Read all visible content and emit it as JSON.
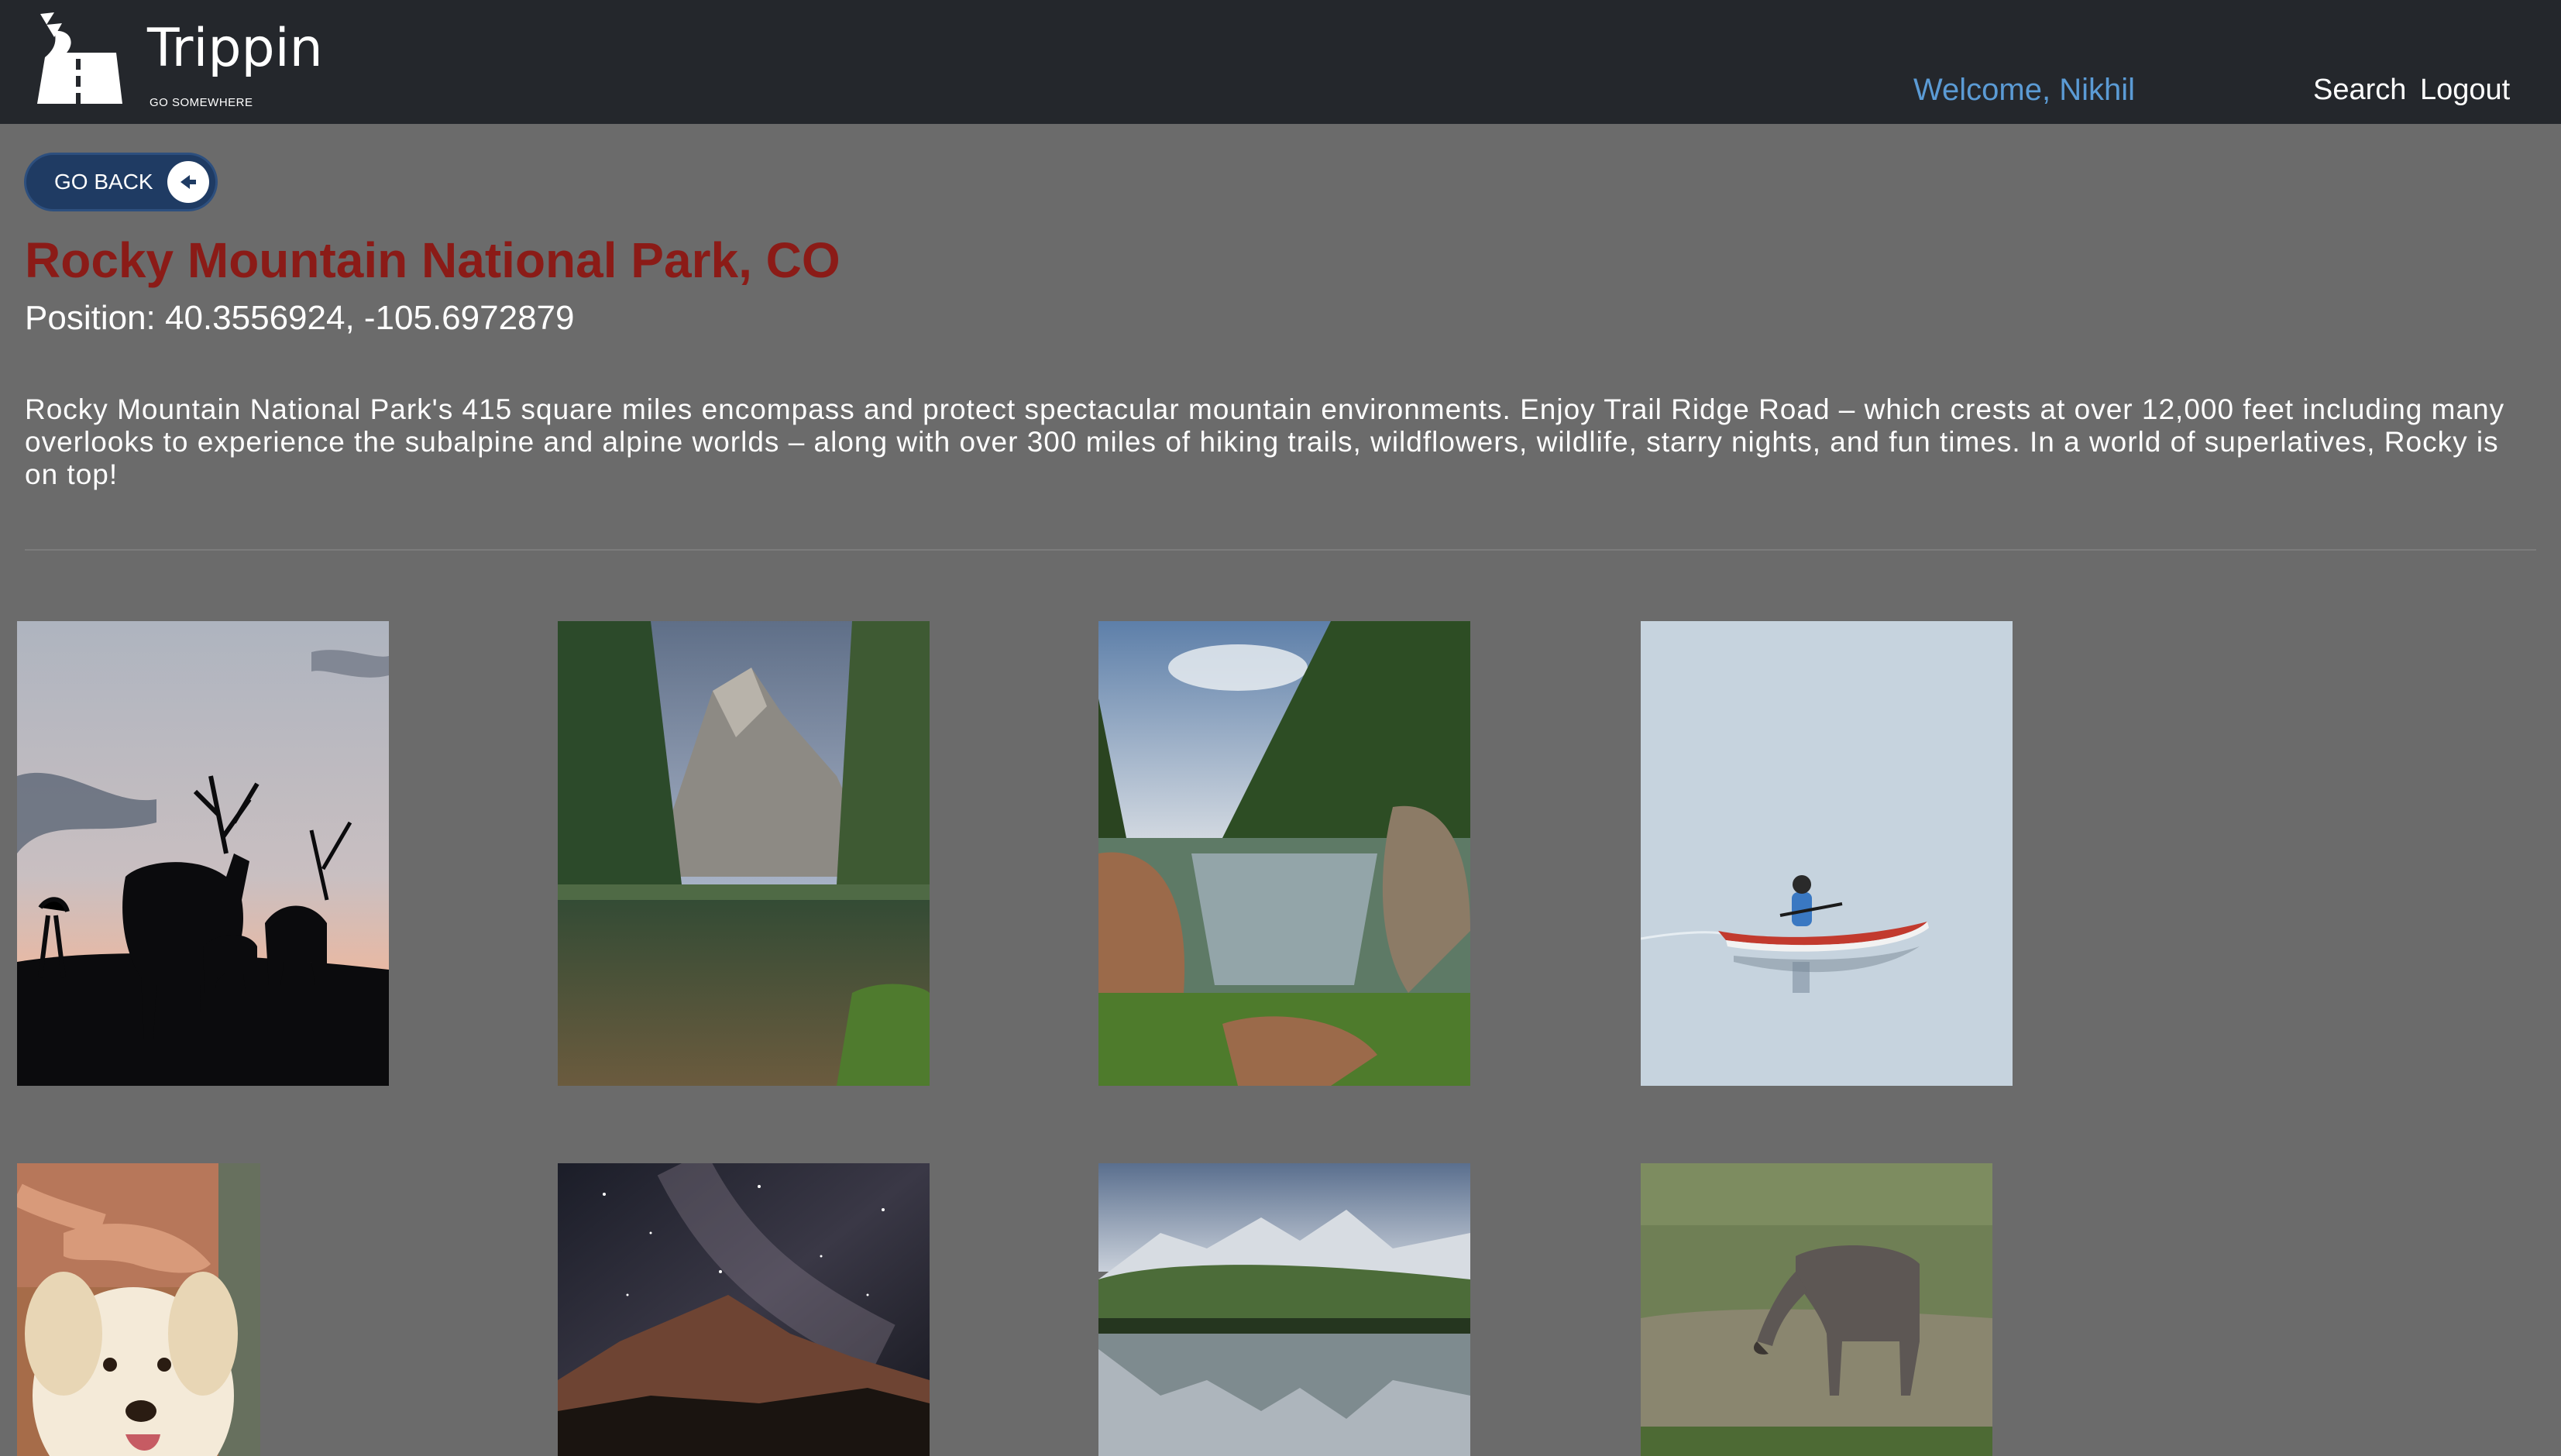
{
  "header": {
    "brand": "Trippin",
    "tagline": "GO SOMEWHERE",
    "welcome": "Welcome, Nikhil",
    "search_label": "Search",
    "logout_label": "Logout"
  },
  "go_back_label": "GO BACK",
  "park": {
    "title": "Rocky Mountain National Park, CO",
    "position": "Position: 40.3556924, -105.6972879",
    "description": "Rocky Mountain National Park's 415 square miles encompass and protect spectacular mountain environments. Enjoy Trail Ridge Road – which crests at over 12,000 feet including many overlooks to experience the subalpine and alpine worlds – along with over 300 miles of hiking trails, wildflowers, wildlife, starry nights, and fun times. In a world of superlatives, Rocky is on top!"
  },
  "photos": [
    {
      "subject": "elk silhouettes at sunset"
    },
    {
      "subject": "mountain lake with forest and peaks"
    },
    {
      "subject": "forest lake between boulders"
    },
    {
      "subject": "kayaker in red kayak on calm water"
    },
    {
      "subject": "golden retriever being petted"
    },
    {
      "subject": "milky way over mountains"
    },
    {
      "subject": "snowy peaks reflected in lake"
    },
    {
      "subject": "elk grazing in meadow"
    }
  ],
  "colors": {
    "topbar": "#24272c",
    "page_background": "#6b6b6b",
    "title": "#8b1b17",
    "welcome": "#5b9bd5",
    "go_back_button": "#1f3b63"
  }
}
